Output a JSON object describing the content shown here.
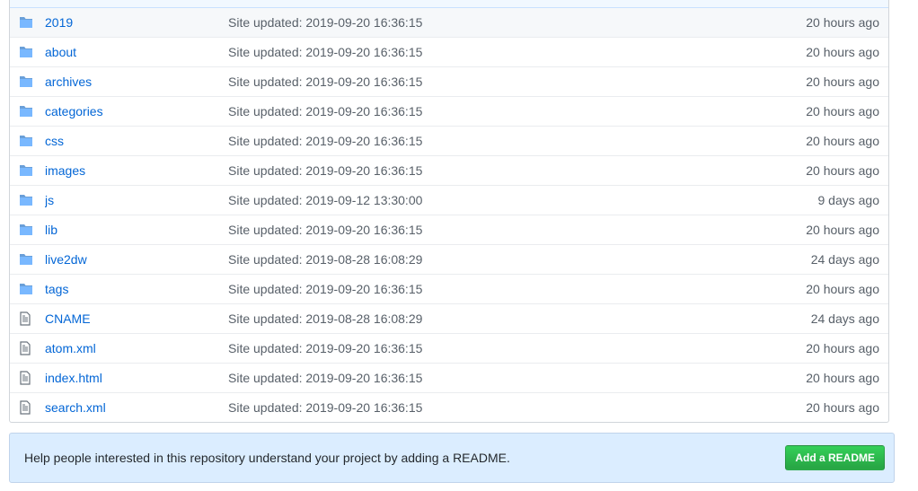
{
  "files": [
    {
      "type": "folder",
      "name": "2019",
      "message": "Site updated: 2019-09-20 16:36:15",
      "age": "20 hours ago"
    },
    {
      "type": "folder",
      "name": "about",
      "message": "Site updated: 2019-09-20 16:36:15",
      "age": "20 hours ago"
    },
    {
      "type": "folder",
      "name": "archives",
      "message": "Site updated: 2019-09-20 16:36:15",
      "age": "20 hours ago"
    },
    {
      "type": "folder",
      "name": "categories",
      "message": "Site updated: 2019-09-20 16:36:15",
      "age": "20 hours ago"
    },
    {
      "type": "folder",
      "name": "css",
      "message": "Site updated: 2019-09-20 16:36:15",
      "age": "20 hours ago"
    },
    {
      "type": "folder",
      "name": "images",
      "message": "Site updated: 2019-09-20 16:36:15",
      "age": "20 hours ago"
    },
    {
      "type": "folder",
      "name": "js",
      "message": "Site updated: 2019-09-12 13:30:00",
      "age": "9 days ago"
    },
    {
      "type": "folder",
      "name": "lib",
      "message": "Site updated: 2019-09-20 16:36:15",
      "age": "20 hours ago"
    },
    {
      "type": "folder",
      "name": "live2dw",
      "message": "Site updated: 2019-08-28 16:08:29",
      "age": "24 days ago"
    },
    {
      "type": "folder",
      "name": "tags",
      "message": "Site updated: 2019-09-20 16:36:15",
      "age": "20 hours ago"
    },
    {
      "type": "file",
      "name": "CNAME",
      "message": "Site updated: 2019-08-28 16:08:29",
      "age": "24 days ago"
    },
    {
      "type": "file",
      "name": "atom.xml",
      "message": "Site updated: 2019-09-20 16:36:15",
      "age": "20 hours ago"
    },
    {
      "type": "file",
      "name": "index.html",
      "message": "Site updated: 2019-09-20 16:36:15",
      "age": "20 hours ago"
    },
    {
      "type": "file",
      "name": "search.xml",
      "message": "Site updated: 2019-09-20 16:36:15",
      "age": "20 hours ago"
    }
  ],
  "icons": {
    "folder": "folder-icon",
    "file": "file-icon"
  },
  "colors": {
    "link": "#0366d6",
    "muted": "#586069",
    "folder_icon": "#79b8ff",
    "file_icon": "#6a737d",
    "banner_bg": "#dbedff",
    "button_green": "#28a745"
  },
  "readme": {
    "text": "Help people interested in this repository understand your project by adding a README.",
    "button_label": "Add a README"
  }
}
